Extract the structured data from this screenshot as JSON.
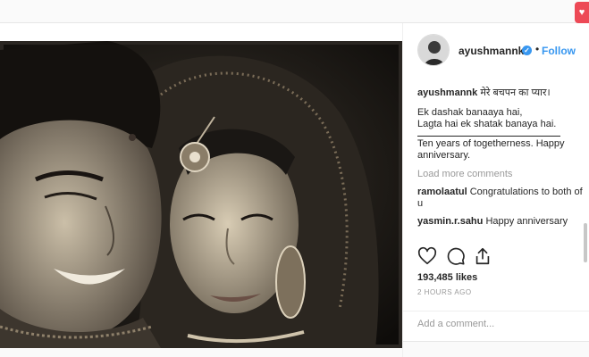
{
  "post": {
    "username": "ayushmannk",
    "verified": true,
    "follow_label": "Follow",
    "dot": "•",
    "caption": {
      "username": "ayushmannk",
      "text_hindi": "मेरे बचपन का प्यार।",
      "lines_block1": [
        "Ek dashak banaaya hai,",
        "Lagta hai ek shatak banaya hai."
      ],
      "lines_block2": [
        "Ten years of togetherness. Happy",
        "anniversary."
      ]
    },
    "load_more": "Load more comments",
    "comments": [
      {
        "user": "ramolaatul",
        "text": "Congratulations to both of u"
      },
      {
        "user": "yasmin.r.sahu",
        "text": "Happy anniversary"
      }
    ],
    "likes": "193,485 likes",
    "time": "2 HOURS AGO",
    "add_comment_placeholder": "Add a comment..."
  },
  "icons": {
    "verified": "verified-badge-icon",
    "like": "heart-icon",
    "comment": "comment-bubble-icon",
    "share": "share-icon",
    "notification": "heart-notification-icon"
  },
  "colors": {
    "accent": "#3897f0",
    "text": "#262626",
    "muted": "#999999",
    "notification": "#ed4956"
  }
}
